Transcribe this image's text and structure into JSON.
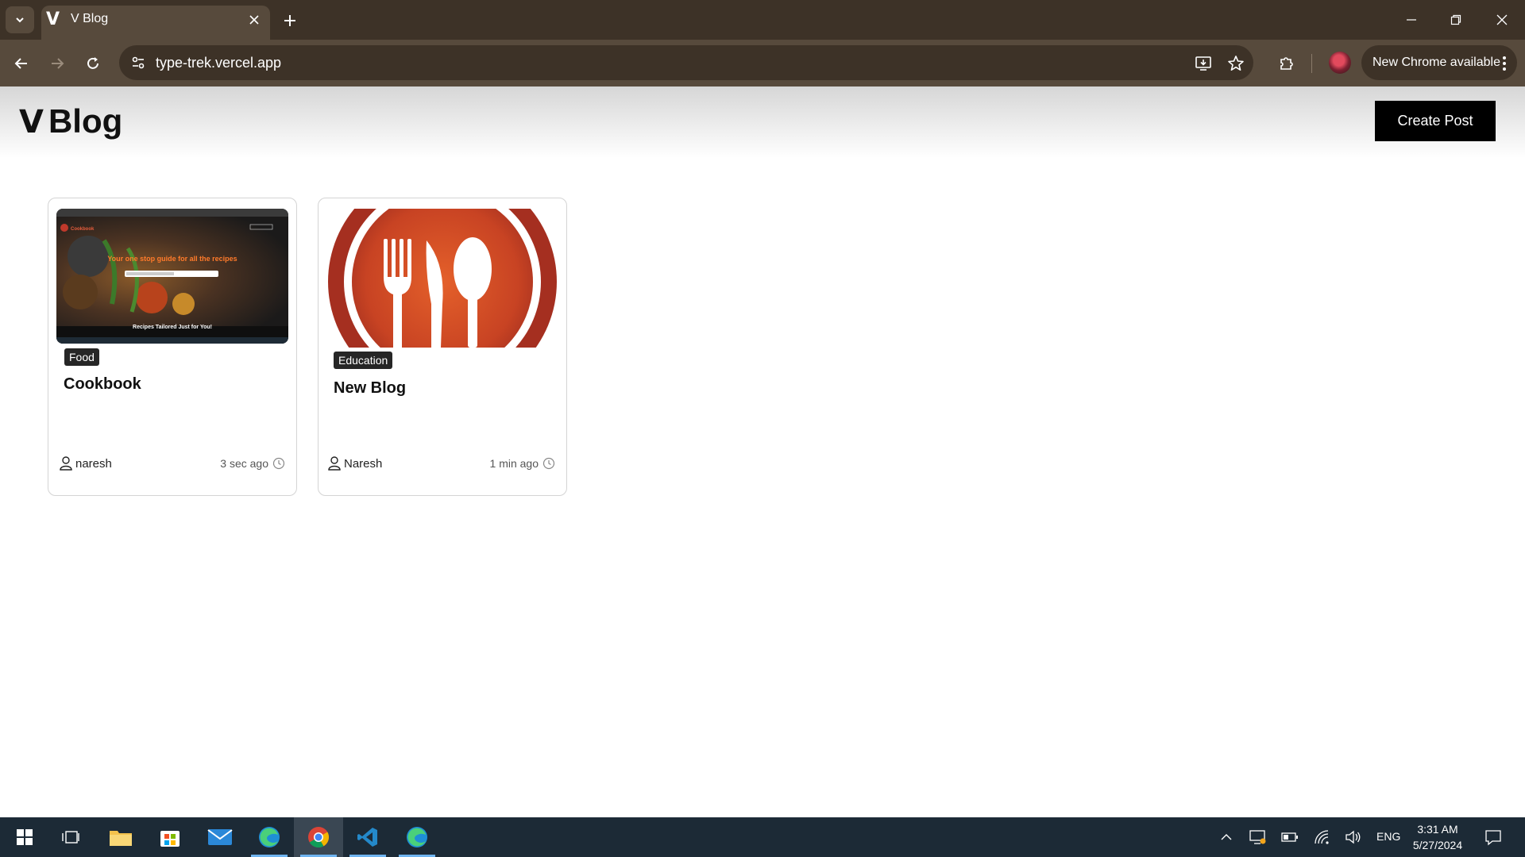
{
  "browser": {
    "tab_title": "V Blog",
    "tab_favicon": "V",
    "url": "type-trek.vercel.app",
    "update_label": "New Chrome available"
  },
  "site": {
    "logo_mark": "V",
    "logo_text": "Blog",
    "create_post_label": "Create Post"
  },
  "posts": [
    {
      "category": "Food",
      "title": "Cookbook",
      "author": "naresh",
      "time_ago": "3 sec ago",
      "thumb_headline": "Your one stop guide for all the recipes",
      "thumb_footer": "Recipes Tailored Just for You!",
      "thumb_brand": "Cookbook"
    },
    {
      "category": "Education",
      "title": "New Blog",
      "author": "Naresh",
      "time_ago": "1 min ago"
    }
  ],
  "taskbar": {
    "time": "3:31 AM",
    "date": "5/27/2024",
    "language": "ENG"
  }
}
